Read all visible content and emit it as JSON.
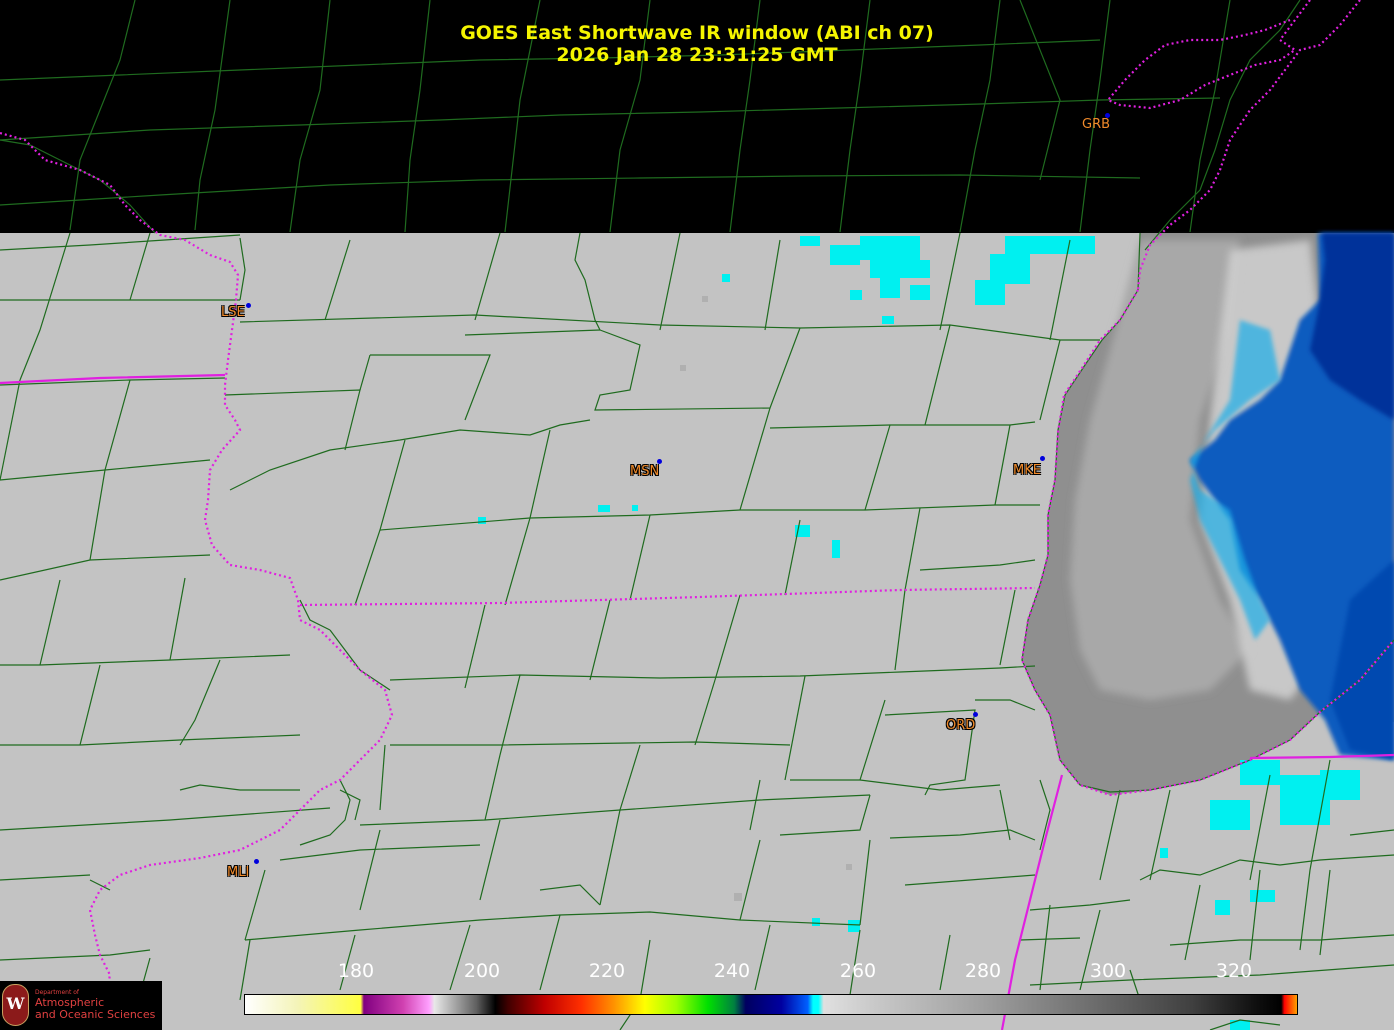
{
  "header": {
    "title": "GOES East Shortwave IR window (ABI ch 07)",
    "timestamp": "2026 Jan 28  23:31:25 GMT"
  },
  "stations": [
    {
      "id": "GRB"
    },
    {
      "id": "LSE"
    },
    {
      "id": "MSN"
    },
    {
      "id": "MKE"
    },
    {
      "id": "ORD"
    },
    {
      "id": "MLI"
    }
  ],
  "colorbar": {
    "ticks": [
      "180",
      "200",
      "220",
      "240",
      "260",
      "280",
      "300",
      "320"
    ]
  },
  "logo": {
    "line1": "Department of",
    "line2": "Atmospheric",
    "line3": "and Oceanic Sciences"
  },
  "colors": {
    "title": "#f5f500",
    "county_lines": "#1f6b1f",
    "state_lines": "#e020e0",
    "station_label": "#f08a2a",
    "station_dot": "#0000dd",
    "land": "#c3c3c3",
    "lake": "#8f8f8f"
  }
}
